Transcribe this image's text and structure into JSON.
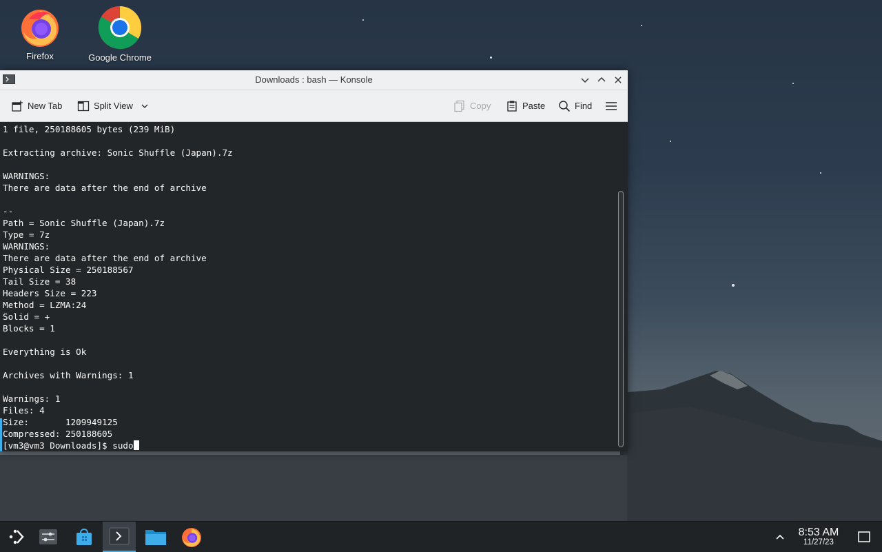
{
  "desktop": {
    "icons": [
      {
        "label": "Firefox",
        "icon": "firefox-icon"
      },
      {
        "label": "Google Chrome",
        "icon": "chrome-icon"
      }
    ]
  },
  "window": {
    "title": "Downloads : bash — Konsole",
    "toolbar": {
      "new_tab": "New Tab",
      "split_view": "Split View",
      "copy": "Copy",
      "paste": "Paste",
      "find": "Find"
    }
  },
  "terminal": {
    "lines": [
      "1 file, 250188605 bytes (239 MiB)",
      "",
      "Extracting archive: Sonic Shuffle (Japan).7z",
      "",
      "WARNINGS:",
      "There are data after the end of archive",
      "",
      "--",
      "Path = Sonic Shuffle (Japan).7z",
      "Type = 7z",
      "WARNINGS:",
      "There are data after the end of archive",
      "Physical Size = 250188567",
      "Tail Size = 38",
      "Headers Size = 223",
      "Method = LZMA:24",
      "Solid = +",
      "Blocks = 1",
      "",
      "Everything is Ok",
      "",
      "Archives with Warnings: 1",
      "",
      "Warnings: 1",
      "Files: 4",
      "Size:       1209949125",
      "Compressed: 250188605"
    ],
    "prompt": "[vm3@vm3 Downloads]$ ",
    "input": "sudo"
  },
  "taskbar": {
    "items": [
      "application-launcher-icon",
      "system-settings-icon",
      "discover-store-icon",
      "konsole-icon",
      "file-manager-icon",
      "firefox-icon"
    ],
    "time": "8:53 AM",
    "date": "11/27/23"
  },
  "colors": {
    "accent": "#3daee9",
    "terminal_bg": "#232629",
    "terminal_fg": "#fcfcfc",
    "titlebar_bg": "#eff0f1",
    "taskbar_bg": "#202326"
  }
}
